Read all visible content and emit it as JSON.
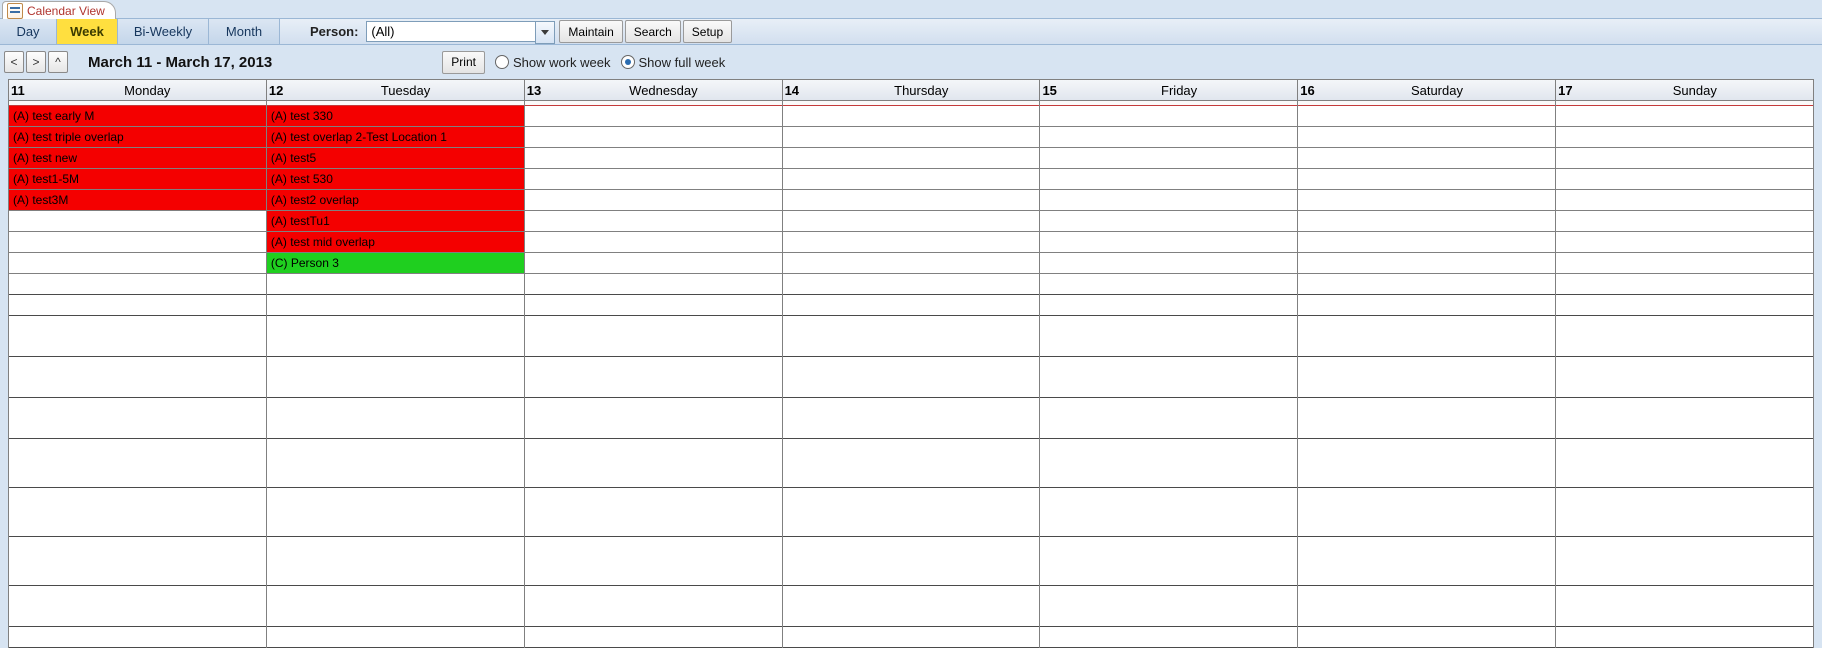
{
  "tab": {
    "title": "Calendar View"
  },
  "toolbar": {
    "views": [
      {
        "id": "day",
        "label": "Day",
        "active": false
      },
      {
        "id": "week",
        "label": "Week",
        "active": true
      },
      {
        "id": "biweekly",
        "label": "Bi-Weekly",
        "active": false
      },
      {
        "id": "month",
        "label": "Month",
        "active": false
      }
    ],
    "person_label": "Person:",
    "person_value": "(All)",
    "maintain_label": "Maintain",
    "search_label": "Search",
    "setup_label": "Setup"
  },
  "subbar": {
    "nav_prev": "<",
    "nav_next": ">",
    "nav_up": "^",
    "date_range": "March 11 - March 17, 2013",
    "print_label": "Print",
    "work_week_label": "Show work week",
    "full_week_label": "Show full week",
    "week_mode": "full"
  },
  "calendar": {
    "days": [
      {
        "num": "11",
        "name": "Monday"
      },
      {
        "num": "12",
        "name": "Tuesday"
      },
      {
        "num": "13",
        "name": "Wednesday"
      },
      {
        "num": "14",
        "name": "Thursday"
      },
      {
        "num": "15",
        "name": "Friday"
      },
      {
        "num": "16",
        "name": "Saturday"
      },
      {
        "num": "17",
        "name": "Sunday"
      }
    ],
    "top_row_count": 8,
    "events": {
      "0": [
        {
          "row": 0,
          "text": "(A) test early M",
          "color": "red"
        },
        {
          "row": 1,
          "text": "(A) test triple overlap",
          "color": "red"
        },
        {
          "row": 2,
          "text": "(A) test new",
          "color": "red"
        },
        {
          "row": 3,
          "text": "(A) test1-5M",
          "color": "red"
        },
        {
          "row": 4,
          "text": "(A) test3M",
          "color": "red"
        }
      ],
      "1": [
        {
          "row": 0,
          "text": "(A) test 330",
          "color": "red"
        },
        {
          "row": 1,
          "text": "(A) test overlap 2-Test Location 1",
          "color": "red"
        },
        {
          "row": 2,
          "text": "(A) test5",
          "color": "red"
        },
        {
          "row": 3,
          "text": "(A) test 530",
          "color": "red"
        },
        {
          "row": 4,
          "text": "(A) test2 overlap",
          "color": "red"
        },
        {
          "row": 5,
          "text": "(A) testTu1",
          "color": "red"
        },
        {
          "row": 6,
          "text": "(A) test mid overlap",
          "color": "red"
        },
        {
          "row": 7,
          "text": "(C) Person 3",
          "color": "green"
        }
      ]
    },
    "lower_rows": [
      "short",
      "tall",
      "tall",
      "tall",
      "xtall",
      "xtall",
      "xtall",
      "tall",
      "short"
    ]
  },
  "colors": {
    "event_red": "#f40000",
    "event_green": "#1fcf1f",
    "accent_yellow": "#ffdf3f"
  }
}
